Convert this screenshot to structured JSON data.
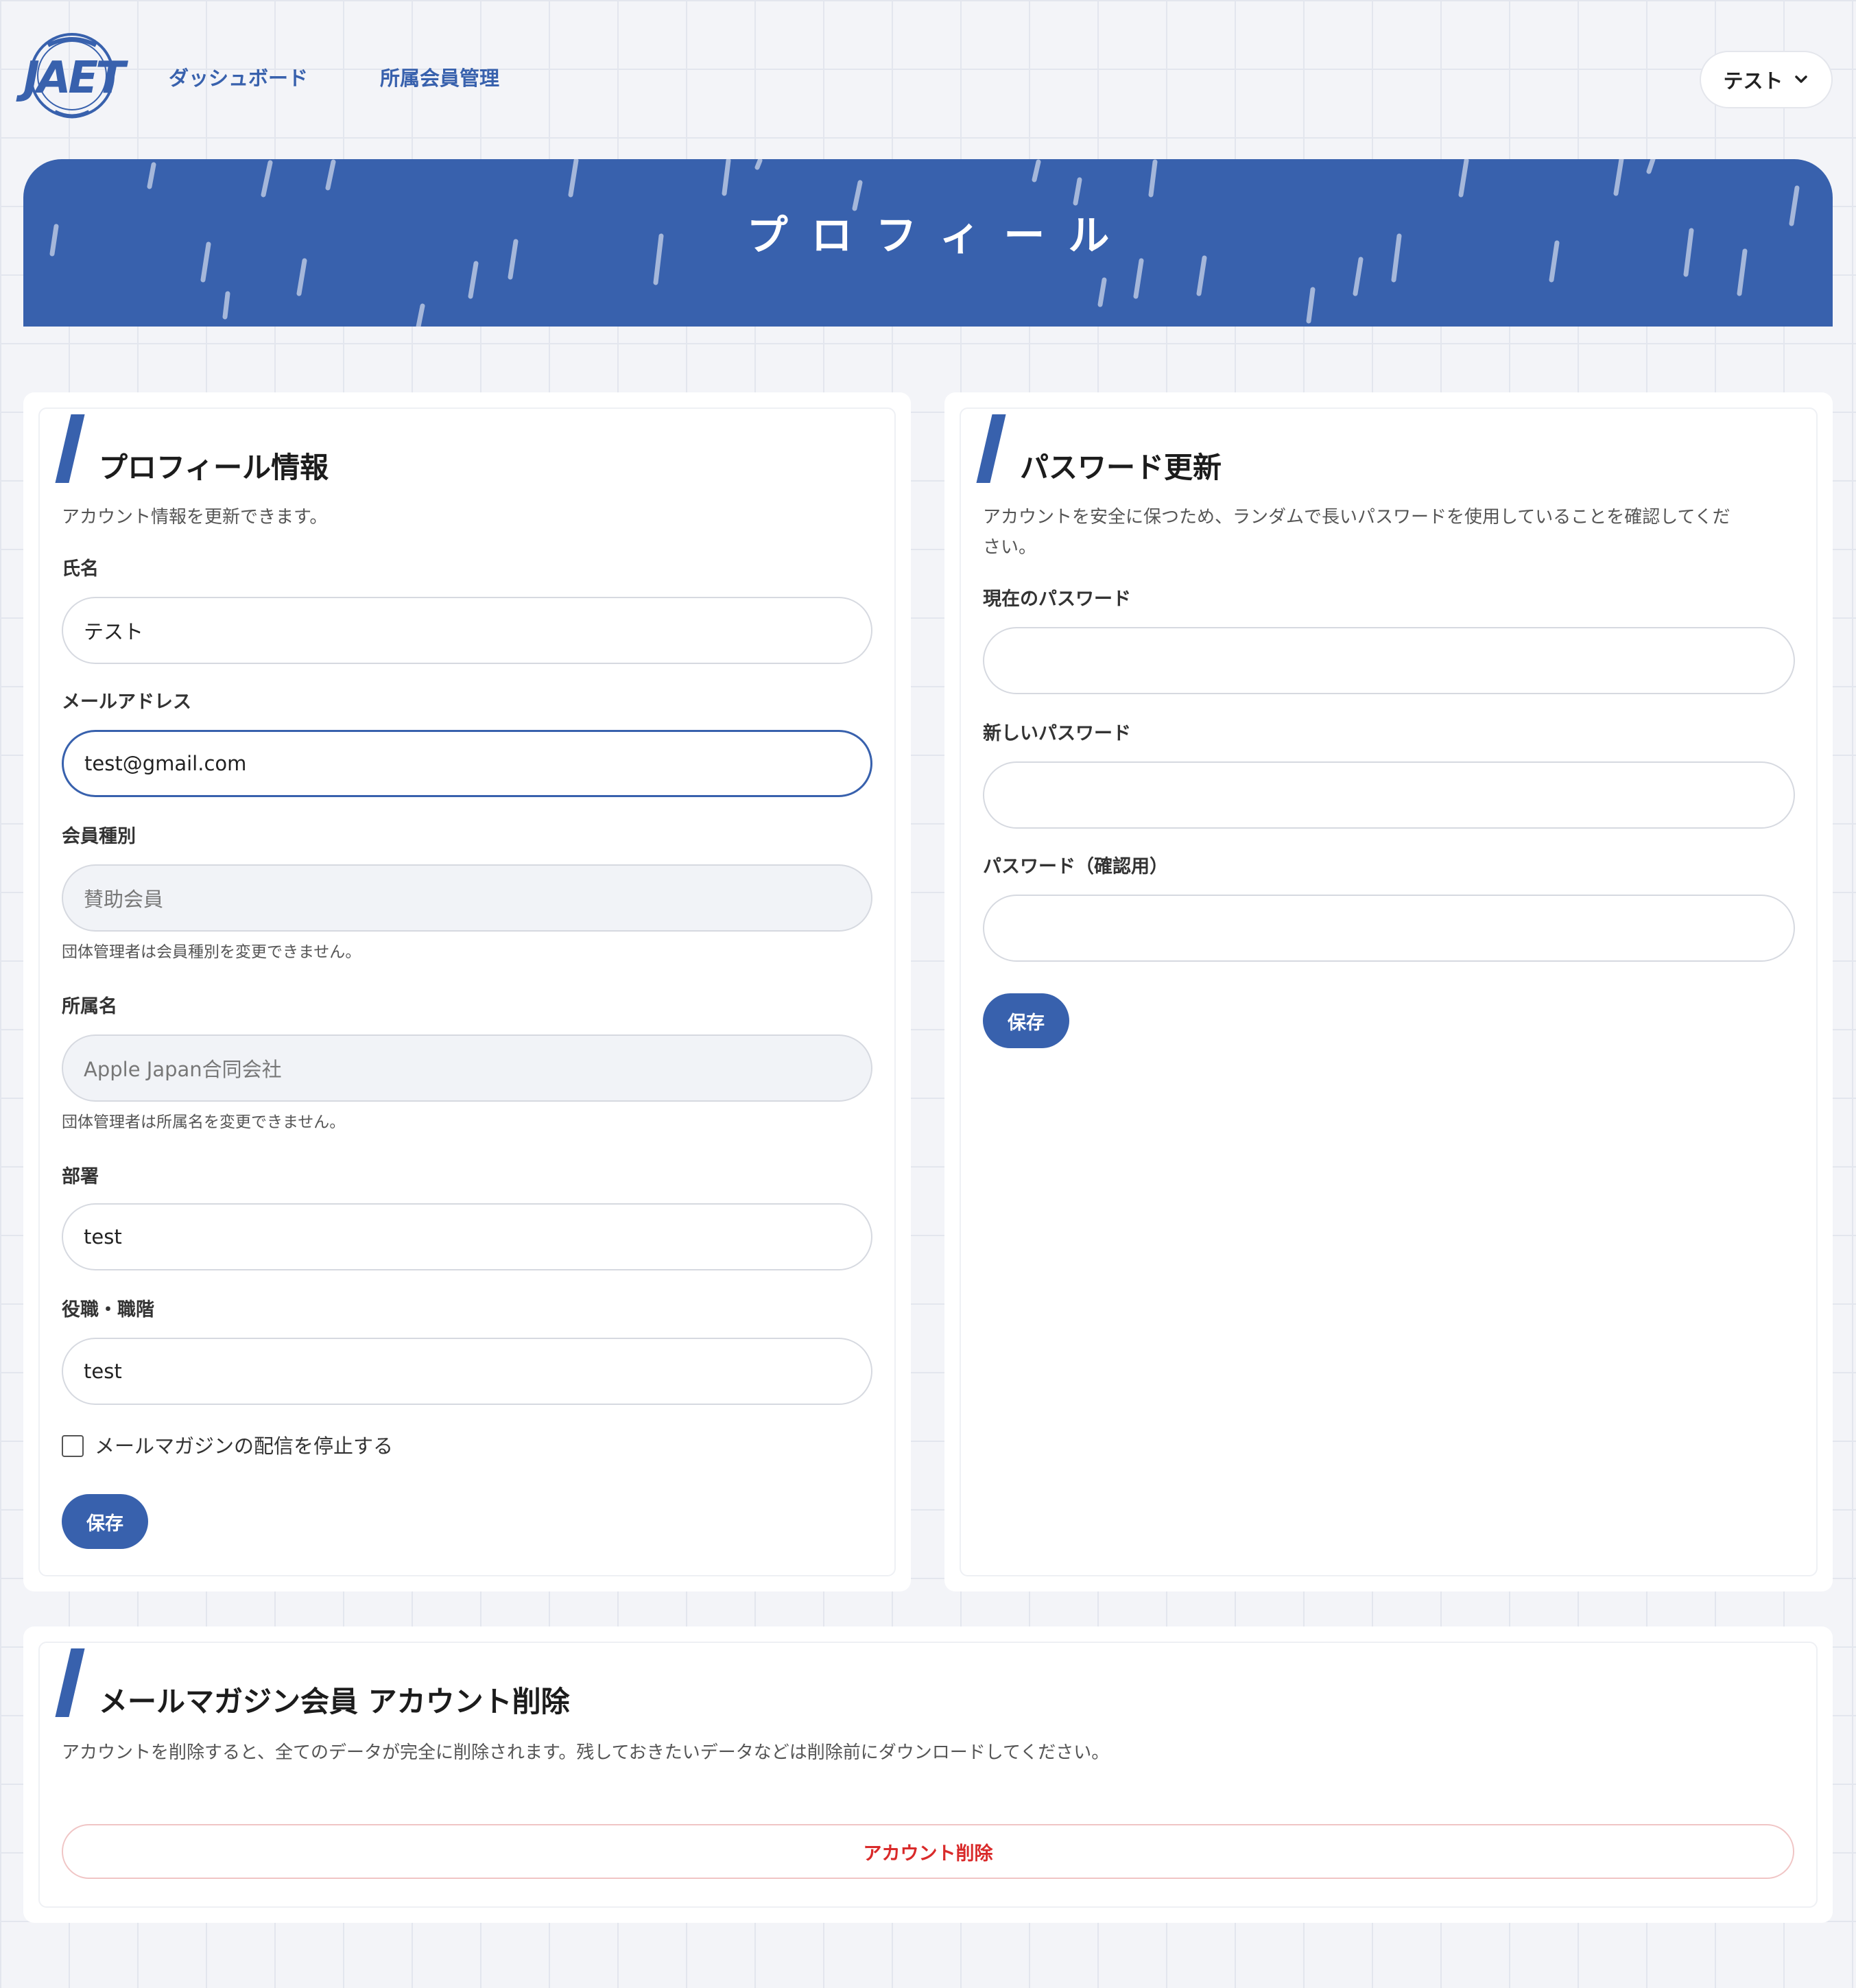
{
  "nav": {
    "logo_text": "JAET",
    "links": [
      "ダッシュボード",
      "所属会員管理"
    ],
    "user_name": "テスト",
    "user_menu_icon": "chevron-down-icon"
  },
  "hero": {
    "title": "プロフィール"
  },
  "profile": {
    "title": "プロフィール情報",
    "description": "アカウント情報を更新できます。",
    "fields": {
      "name": {
        "label": "氏名",
        "value": "テスト"
      },
      "email": {
        "label": "メールアドレス",
        "value": "test@gmail.com"
      },
      "membership": {
        "label": "会員種別",
        "value": "賛助会員",
        "note": "団体管理者は会員種別を変更できません。"
      },
      "organization": {
        "label": "所属名",
        "value": "Apple Japan合同会社",
        "note": "団体管理者は所属名を変更できません。"
      },
      "department": {
        "label": "部署",
        "value": "test"
      },
      "position": {
        "label": "役職・職階",
        "value": "test"
      }
    },
    "newsletter_label": "メールマガジンの配信を停止する",
    "save_label": "保存"
  },
  "password": {
    "title": "パスワード更新",
    "description_line1": "アカウントを安全に保つため、ランダムで長いパスワードを使用していることを確認してくだ",
    "description_line2": "さい。",
    "current_label": "現在のパスワード",
    "new_label": "新しいパスワード",
    "confirm_label": "パスワード（確認用）",
    "save_label": "保存"
  },
  "delete": {
    "title": "メールマガジン会員 アカウント削除",
    "description": "アカウントを削除すると、全てのデータが完全に削除されます。残しておきたいデータなどは削除前にダウンロードしてください。",
    "button_label": "アカウント削除"
  },
  "colors": {
    "primary": "#3861ad",
    "danger": "#d92a2a",
    "background": "#f3f4f8"
  }
}
